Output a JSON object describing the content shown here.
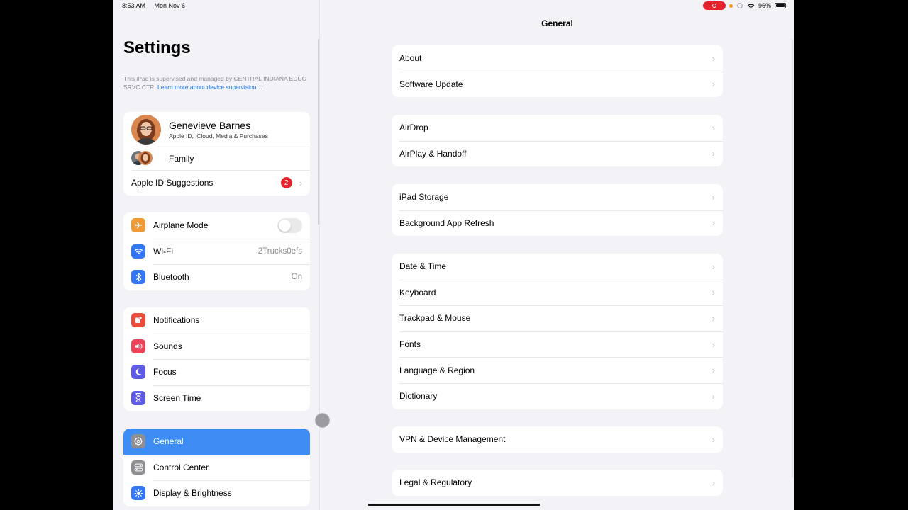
{
  "status_bar": {
    "time": "8:53 AM",
    "date": "Mon Nov 6",
    "battery_percent": "96%",
    "battery_level": 0.96,
    "wifi_icon": "wifi-icon",
    "recording_indicator": "screen-recording-icon"
  },
  "sidebar": {
    "title": "Settings",
    "supervision_note": "This iPad is supervised and managed by CENTRAL INDIANA EDUC SRVC CTR.",
    "supervision_link": "Learn more about device supervision…",
    "profile": {
      "name": "Genevieve Barnes",
      "subtitle": "Apple ID, iCloud, Media & Purchases",
      "family_label": "Family",
      "suggestions_label": "Apple ID Suggestions",
      "suggestions_badge": "2"
    },
    "connectivity": [
      {
        "label": "Airplane Mode",
        "icon": "airplane-icon",
        "color": "#f09a37",
        "toggle": false
      },
      {
        "label": "Wi-Fi",
        "icon": "wifi-icon",
        "color": "#3478f6",
        "value": "2Trucks0efs"
      },
      {
        "label": "Bluetooth",
        "icon": "bluetooth-icon",
        "color": "#3478f6",
        "value": "On"
      }
    ],
    "notifications_group": [
      {
        "label": "Notifications",
        "icon": "bell-icon",
        "color": "#eb4d3d"
      },
      {
        "label": "Sounds",
        "icon": "speaker-icon",
        "color": "#eb445a"
      },
      {
        "label": "Focus",
        "icon": "moon-icon",
        "color": "#5e5ce6"
      },
      {
        "label": "Screen Time",
        "icon": "hourglass-icon",
        "color": "#5e5ce6"
      }
    ],
    "general_group": [
      {
        "label": "General",
        "icon": "gear-icon",
        "color": "#8e8e93",
        "selected": true
      },
      {
        "label": "Control Center",
        "icon": "switches-icon",
        "color": "#8e8e93"
      },
      {
        "label": "Display & Brightness",
        "icon": "sun-icon",
        "color": "#3478f6"
      }
    ]
  },
  "detail": {
    "title": "General",
    "groups": [
      [
        "About",
        "Software Update"
      ],
      [
        "AirDrop",
        "AirPlay & Handoff"
      ],
      [
        "iPad Storage",
        "Background App Refresh"
      ],
      [
        "Date & Time",
        "Keyboard",
        "Trackpad & Mouse",
        "Fonts",
        "Language & Region",
        "Dictionary"
      ],
      [
        "VPN & Device Management"
      ],
      [
        "Legal & Regulatory"
      ]
    ]
  },
  "colors": {
    "accent": "#3d8df5",
    "background": "#f2f2f7",
    "badge": "#e5232d"
  }
}
